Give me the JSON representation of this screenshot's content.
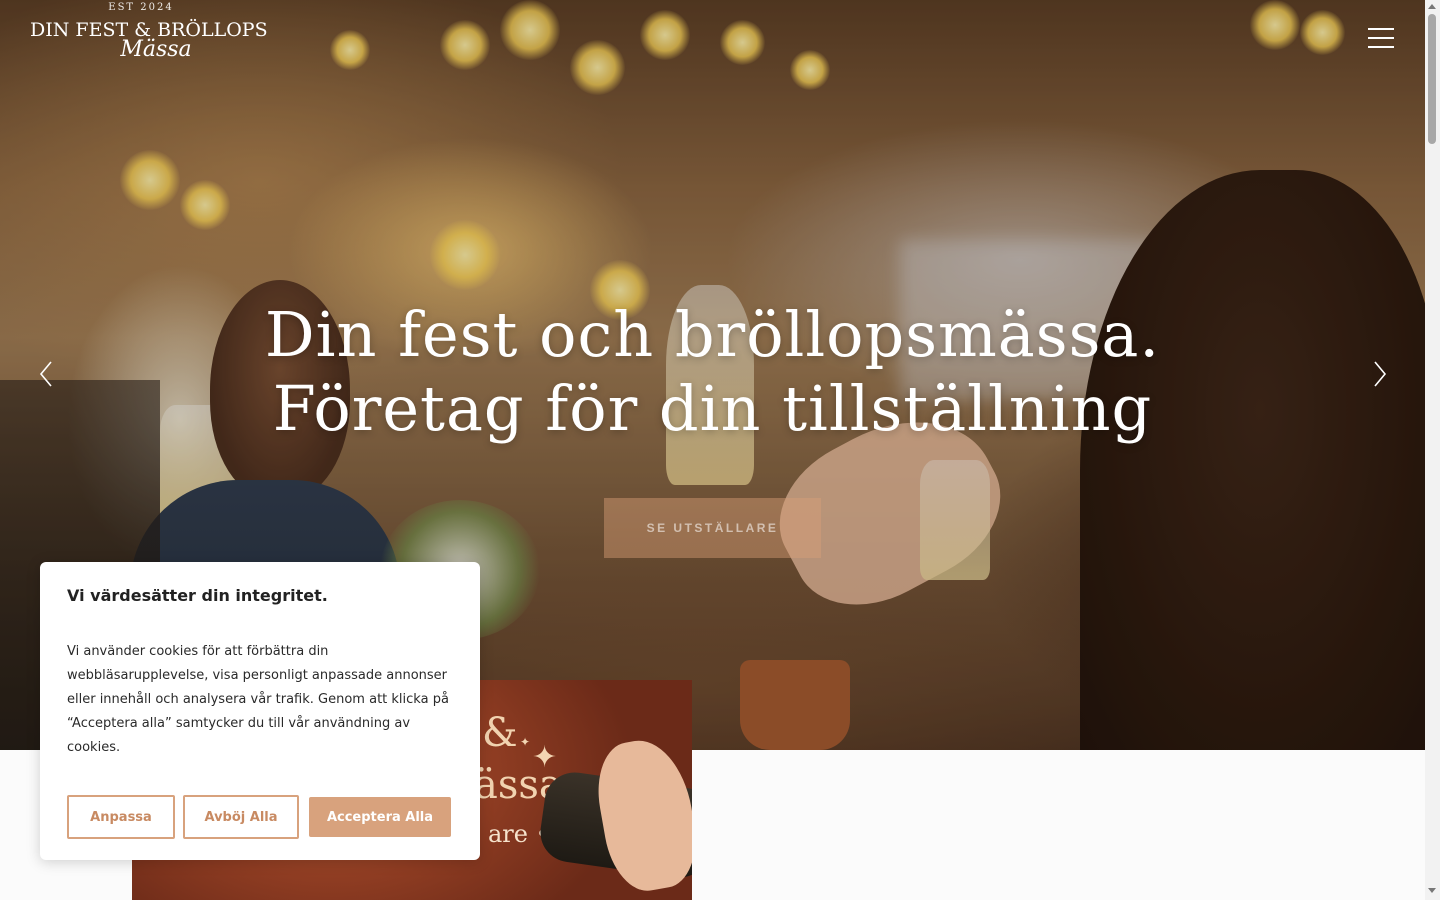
{
  "header": {
    "logo_est": "EST 2024",
    "logo_main": "DIN FEST & BRÖLLOPS",
    "logo_script": "Mässa",
    "menu_icon": "hamburger-menu-icon"
  },
  "hero": {
    "title_line1": "Din fest och bröllopsmässa.",
    "title_line2": "Företag för din tillställning",
    "cta_label": "SE UTSTÄLLARE",
    "prev_icon": "chevron-left-icon",
    "next_icon": "chevron-right-icon"
  },
  "promo": {
    "line1": "&",
    "line2": "ässa",
    "line3": "are • Fri entré"
  },
  "cookie": {
    "title": "Vi värdesätter din integritet.",
    "body": "Vi använder cookies för att förbättra din webbläsarupplevelse, visa personligt anpassade annonser eller innehåll och analysera vår trafik. Genom att klicka på “Acceptera alla” samtycker du till vår användning av cookies.",
    "customize_label": "Anpassa",
    "reject_label": "Avböj Alla",
    "accept_label": "Acceptera Alla"
  },
  "colors": {
    "accent": "#d8a27d",
    "promo_bg": "#8e3c22"
  }
}
